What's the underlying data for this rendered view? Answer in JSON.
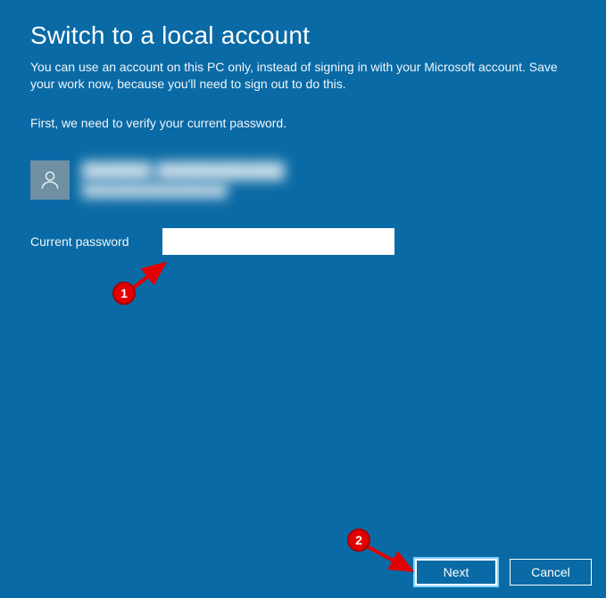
{
  "title": "Switch to a local account",
  "description": "You can use an account on this PC only, instead of signing in with your Microsoft account. Save your work now, because you'll need to sign out to do this.",
  "verify_prompt": "First, we need to verify your current password.",
  "user": {
    "display_name": "██████ ███████████",
    "email": "████████████████"
  },
  "password": {
    "label": "Current password",
    "value": "",
    "placeholder": ""
  },
  "buttons": {
    "next": "Next",
    "cancel": "Cancel"
  },
  "annotations": {
    "b1": "1",
    "b2": "2"
  }
}
